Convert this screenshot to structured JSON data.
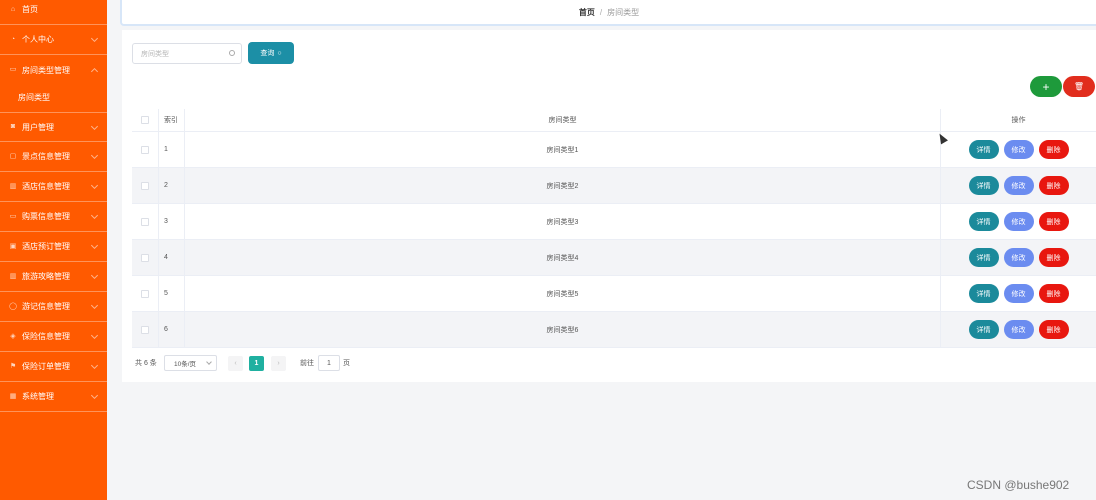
{
  "sidebar": {
    "items": [
      {
        "label": "首页",
        "icon": "home-icon",
        "glyph": "⌂"
      },
      {
        "label": "个人中心",
        "icon": "user-icon",
        "glyph": "◔"
      },
      {
        "label": "房间类型管理",
        "icon": "list-icon",
        "glyph": "▭"
      },
      {
        "label": "用户管理",
        "icon": "users-icon",
        "glyph": "◙"
      },
      {
        "label": "景点信息管理",
        "icon": "map-icon",
        "glyph": "▢"
      },
      {
        "label": "酒店信息管理",
        "icon": "hotel-icon",
        "glyph": "▥"
      },
      {
        "label": "购票信息管理",
        "icon": "ticket-icon",
        "glyph": "▭"
      },
      {
        "label": "酒店预订管理",
        "icon": "calendar-icon",
        "glyph": "▣"
      },
      {
        "label": "旅游攻略管理",
        "icon": "chart-icon",
        "glyph": "▥"
      },
      {
        "label": "游记信息管理",
        "icon": "info-icon",
        "glyph": "◯"
      },
      {
        "label": "保险信息管理",
        "icon": "shield-icon",
        "glyph": "◈"
      },
      {
        "label": "保险订单管理",
        "icon": "flag-icon",
        "glyph": "⚑"
      },
      {
        "label": "系统管理",
        "icon": "settings-icon",
        "glyph": "▦"
      }
    ],
    "sub_item": "房间类型"
  },
  "breadcrumb": {
    "home": "首页",
    "separator": "/",
    "current": "房间类型"
  },
  "search": {
    "placeholder": "房间类型",
    "button_label": "查询"
  },
  "actions": {
    "add_label": "+",
    "delete_label": "🗑"
  },
  "table": {
    "headers": {
      "index": "索引",
      "name": "房间类型",
      "ops": "操作"
    },
    "rows": [
      {
        "index": "1",
        "name": "房间类型1"
      },
      {
        "index": "2",
        "name": "房间类型2"
      },
      {
        "index": "3",
        "name": "房间类型3"
      },
      {
        "index": "4",
        "name": "房间类型4"
      },
      {
        "index": "5",
        "name": "房间类型5"
      },
      {
        "index": "6",
        "name": "房间类型6"
      }
    ],
    "op_labels": {
      "detail": "详情",
      "edit": "修改",
      "delete": "删除"
    }
  },
  "pagination": {
    "total": "共 6 条",
    "page_size": "10条/页",
    "current_page": "1",
    "goto_label": "前往",
    "goto_value": "1",
    "unit": "页"
  },
  "watermark": "CSDN @bushe902",
  "colors": {
    "sidebar": "#ff5a00",
    "primary": "#1c8fa6",
    "add": "#1e9a3b",
    "danger": "#e12d1d",
    "edit": "#6b8cf0"
  }
}
